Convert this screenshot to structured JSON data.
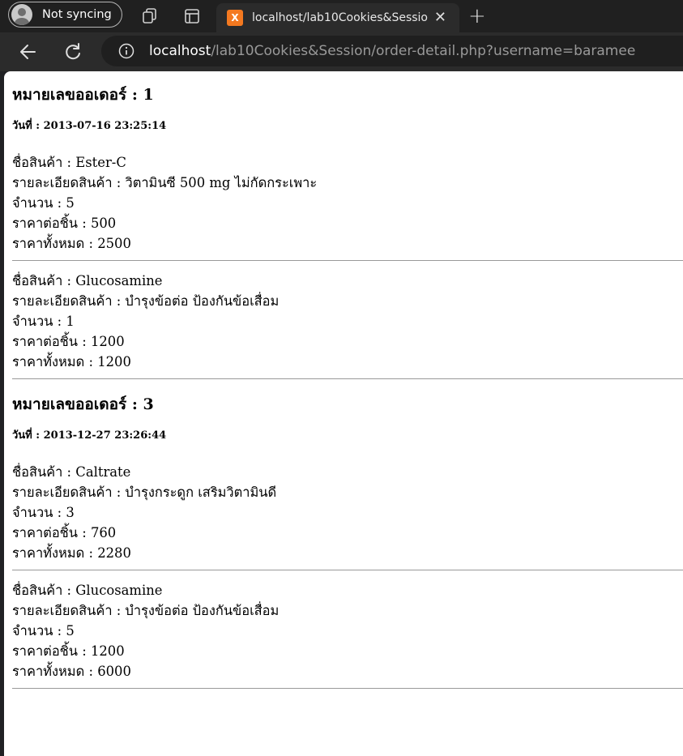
{
  "browser": {
    "profile_label": "Not syncing",
    "tab_title": "localhost/lab10Cookies&Session/order-detail.php?username=baramee",
    "favicon_text": "X",
    "url_host": "localhost",
    "url_path": "/lab10Cookies&Session/order-detail.php?username=baramee",
    "icons": [
      "profile-avatar-icon",
      "workspaces-icon",
      "vertical-tabs-icon",
      "close-icon",
      "new-tab-icon",
      "back-icon",
      "refresh-icon",
      "info-icon"
    ]
  },
  "labels": {
    "order": "หมายเลขออเดอร์ : ",
    "date": "วันที่ : ",
    "name": "ชื่อสินค้า : ",
    "detail": "รายละเอียดสินค้า : ",
    "qty": "จำนวน : ",
    "price": "ราคาต่อชิ้น : ",
    "total": "ราคาทั้งหมด : "
  },
  "orders": [
    {
      "number": "1",
      "date": "2013-07-16 23:25:14",
      "items": [
        {
          "name": "Ester-C",
          "detail": "วิตามินซี 500 mg ไม่กัดกระเพาะ",
          "qty": "5",
          "price": "500",
          "total": "2500"
        },
        {
          "name": "Glucosamine",
          "detail": "บำรุงข้อต่อ ป้องกันข้อเสื่อม",
          "qty": "1",
          "price": "1200",
          "total": "1200"
        }
      ]
    },
    {
      "number": "3",
      "date": "2013-12-27 23:26:44",
      "items": [
        {
          "name": "Caltrate",
          "detail": "บำรุงกระดูก เสริมวิตามินดี",
          "qty": "3",
          "price": "760",
          "total": "2280"
        },
        {
          "name": "Glucosamine",
          "detail": "บำรุงข้อต่อ ป้องกันข้อเสื่อม",
          "qty": "5",
          "price": "1200",
          "total": "6000"
        }
      ]
    }
  ]
}
